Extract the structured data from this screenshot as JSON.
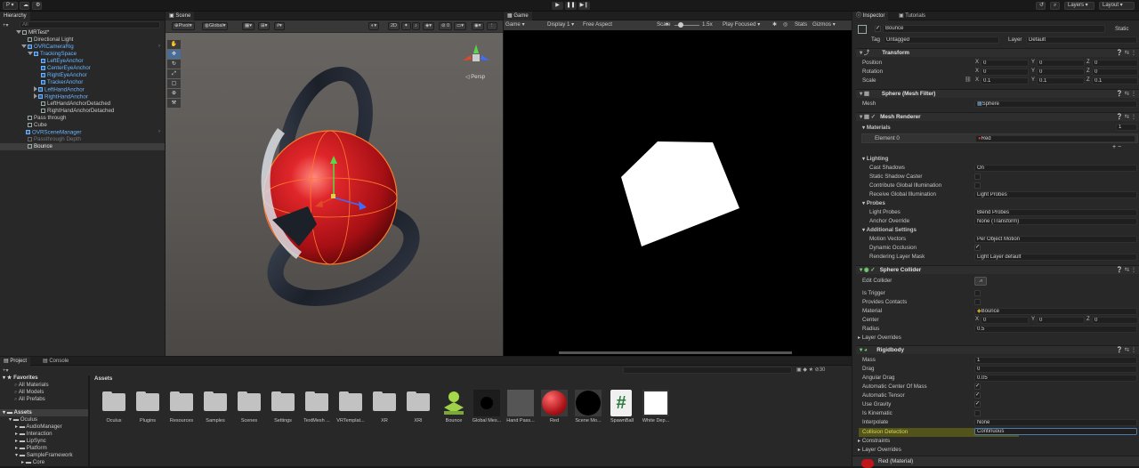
{
  "topbar": {
    "account": "P ▾",
    "play_icon": "play-icon",
    "pause_icon": "pause-icon",
    "step_icon": "step-icon",
    "layers": "Layers",
    "layout": "Layout"
  },
  "hierarchy": {
    "tab": "Hierarchy",
    "search_placeholder": "All",
    "scene": "MRTest*",
    "items": [
      "Directional Light",
      "OVRCameraRig",
      "TrackingSpace",
      "LeftEyeAnchor",
      "CenterEyeAnchor",
      "RightEyeAnchor",
      "TrackerAnchor",
      "LeftHandAnchor",
      "RightHandAnchor",
      "LeftHandAnchorDetached",
      "RightHandAnchorDetached",
      "Pass through",
      "Cube",
      "OVRSceneManager",
      "Passthrough Depth",
      "Bounce"
    ]
  },
  "scene": {
    "tab": "Scene",
    "pivot": "Pivot",
    "global": "Global",
    "mode_2d": "2D",
    "persp": "Persp"
  },
  "game": {
    "tab": "Game",
    "mode": "Game",
    "display": "Display 1",
    "aspect": "Free Aspect",
    "scale_label": "Scale",
    "scale_value": "1.5x",
    "play_focused": "Play Focused",
    "stats": "Stats",
    "gizmos": "Gizmos"
  },
  "project": {
    "tabs": [
      "Project",
      "Console"
    ],
    "count": "30",
    "favorites": {
      "title": "Favorites",
      "items": [
        "All Materials",
        "All Models",
        "All Prefabs"
      ]
    },
    "tree": [
      "Assets",
      "Oculus",
      "AudioManager",
      "Interaction",
      "LipSync",
      "Platform",
      "SampleFramework",
      "Core"
    ],
    "breadcrumb": "Assets",
    "assets": [
      "Oculus",
      "Plugins",
      "Resources",
      "Samples",
      "Scenes",
      "Settings",
      "TextMesh ...",
      "VRTemplat...",
      "XR",
      "XRI",
      "Bounce",
      "Global Mes...",
      "Hand Pass...",
      "Red",
      "Scene Mo...",
      "SpawnBall",
      "White Dep..."
    ]
  },
  "inspector": {
    "tabs": [
      "Inspector",
      "Tutorials"
    ],
    "object_name": "Bounce",
    "static": "Static",
    "tag_label": "Tag",
    "tag_value": "Untagged",
    "layer_label": "Layer",
    "layer_value": "Default",
    "transform": {
      "title": "Transform",
      "position_label": "Position",
      "rotation_label": "Rotation",
      "scale_label": "Scale",
      "position": [
        "0",
        "0",
        "0"
      ],
      "rotation": [
        "0",
        "0",
        "0"
      ],
      "scale": [
        "0.1",
        "0.1",
        "0.1"
      ]
    },
    "mesh_filter": {
      "title": "Sphere (Mesh Filter)",
      "mesh_label": "Mesh",
      "mesh_value": "Sphere"
    },
    "mesh_renderer": {
      "title": "Mesh Renderer",
      "materials_label": "Materials",
      "materials_count": "1",
      "element_label": "Element 0",
      "element_value": "Red",
      "lighting": "Lighting",
      "cast_shadows_label": "Cast Shadows",
      "cast_shadows_value": "On",
      "static_shadow_label": "Static Shadow Caster",
      "contribute_gi_label": "Contribute Global Illumination",
      "receive_gi_label": "Receive Global Illumination",
      "receive_gi_value": "Light Probes",
      "probes": "Probes",
      "light_probes_label": "Light Probes",
      "light_probes_value": "Blend Probes",
      "anchor_override_label": "Anchor Override",
      "anchor_override_value": "None (Transform)",
      "additional_settings": "Additional Settings",
      "motion_vectors_label": "Motion Vectors",
      "motion_vectors_value": "Per Object Motion",
      "dynamic_occlusion_label": "Dynamic Occlusion",
      "rendering_layer_label": "Rendering Layer Mask",
      "rendering_layer_value": "Light Layer default"
    },
    "sphere_collider": {
      "title": "Sphere Collider",
      "edit_collider_label": "Edit Collider",
      "is_trigger_label": "Is Trigger",
      "provides_contacts_label": "Provides Contacts",
      "material_label": "Material",
      "material_value": "Bounce",
      "center_label": "Center",
      "center": [
        "0",
        "0",
        "0"
      ],
      "radius_label": "Radius",
      "radius_value": "0.5",
      "layer_overrides": "Layer Overrides"
    },
    "rigidbody": {
      "title": "Rigidbody",
      "mass_label": "Mass",
      "mass_value": "1",
      "drag_label": "Drag",
      "drag_value": "0",
      "angular_drag_label": "Angular Drag",
      "angular_drag_value": "0.05",
      "auto_com_label": "Automatic Center Of Mass",
      "auto_tensor_label": "Automatic Tensor",
      "use_gravity_label": "Use Gravity",
      "is_kinematic_label": "Is Kinematic",
      "interpolate_label": "Interpolate",
      "interpolate_value": "None",
      "collision_label": "Collision Detection",
      "collision_value": "Continuous",
      "constraints": "Constraints",
      "layer_overrides": "Layer Overrides"
    },
    "material_footer": "Red (Material)"
  },
  "colors": {
    "accent_blue": "#6cb4ff",
    "highlight_yellow": "#b8b83a",
    "sphere_red": "#c0161a"
  }
}
